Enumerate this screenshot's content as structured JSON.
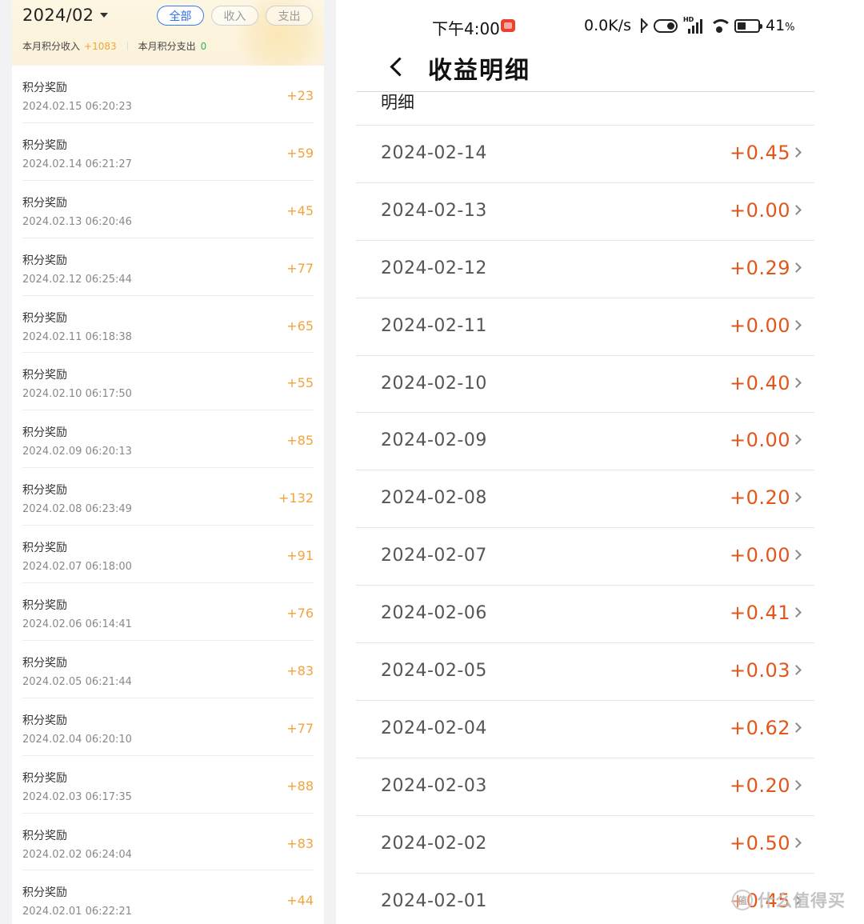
{
  "left": {
    "month": "2024/02",
    "filters": [
      {
        "label": "全部",
        "active": true
      },
      {
        "label": "收入",
        "active": false
      },
      {
        "label": "支出",
        "active": false
      }
    ],
    "summary": {
      "income_label": "本月积分收入",
      "income_value": "+1083",
      "expense_label": "本月积分支出",
      "expense_value": "0"
    },
    "rows": [
      {
        "title": "积分奖励",
        "time": "2024.02.15 06:20:23",
        "amount": "+23"
      },
      {
        "title": "积分奖励",
        "time": "2024.02.14 06:21:27",
        "amount": "+59"
      },
      {
        "title": "积分奖励",
        "time": "2024.02.13 06:20:46",
        "amount": "+45"
      },
      {
        "title": "积分奖励",
        "time": "2024.02.12 06:25:44",
        "amount": "+77"
      },
      {
        "title": "积分奖励",
        "time": "2024.02.11 06:18:38",
        "amount": "+65"
      },
      {
        "title": "积分奖励",
        "time": "2024.02.10 06:17:50",
        "amount": "+55"
      },
      {
        "title": "积分奖励",
        "time": "2024.02.09 06:20:13",
        "amount": "+85"
      },
      {
        "title": "积分奖励",
        "time": "2024.02.08 06:23:49",
        "amount": "+132"
      },
      {
        "title": "积分奖励",
        "time": "2024.02.07 06:18:00",
        "amount": "+91"
      },
      {
        "title": "积分奖励",
        "time": "2024.02.06 06:14:41",
        "amount": "+76"
      },
      {
        "title": "积分奖励",
        "time": "2024.02.05 06:21:44",
        "amount": "+83"
      },
      {
        "title": "积分奖励",
        "time": "2024.02.04 06:20:10",
        "amount": "+77"
      },
      {
        "title": "积分奖励",
        "time": "2024.02.03 06:17:35",
        "amount": "+88"
      },
      {
        "title": "积分奖励",
        "time": "2024.02.02 06:24:04",
        "amount": "+83"
      },
      {
        "title": "积分奖励",
        "time": "2024.02.01 06:22:21",
        "amount": "+44"
      }
    ]
  },
  "right": {
    "status_bar": {
      "time": "下午4:00",
      "net_speed": "0.0K/s",
      "signal_label": "HD",
      "battery_percent": "41",
      "battery_unit": "%",
      "battery_level": 0.41
    },
    "title": "收益明细",
    "section_label": "明细",
    "rows": [
      {
        "date": "2024-02-14",
        "amount": "+0.45"
      },
      {
        "date": "2024-02-13",
        "amount": "+0.00"
      },
      {
        "date": "2024-02-12",
        "amount": "+0.29"
      },
      {
        "date": "2024-02-11",
        "amount": "+0.00"
      },
      {
        "date": "2024-02-10",
        "amount": "+0.40"
      },
      {
        "date": "2024-02-09",
        "amount": "+0.00"
      },
      {
        "date": "2024-02-08",
        "amount": "+0.20"
      },
      {
        "date": "2024-02-07",
        "amount": "+0.00"
      },
      {
        "date": "2024-02-06",
        "amount": "+0.41"
      },
      {
        "date": "2024-02-05",
        "amount": "+0.03"
      },
      {
        "date": "2024-02-04",
        "amount": "+0.62"
      },
      {
        "date": "2024-02-03",
        "amount": "+0.20"
      },
      {
        "date": "2024-02-02",
        "amount": "+0.50"
      },
      {
        "date": "2024-02-01",
        "amount": "+0.45"
      }
    ]
  },
  "watermark": {
    "logo": "值",
    "text": "什么值得买"
  },
  "colors": {
    "points_orange": "#f2a43c",
    "earning_red": "#e2561c",
    "active_blue": "#2f6fe8",
    "expense_green": "#33b35f"
  }
}
